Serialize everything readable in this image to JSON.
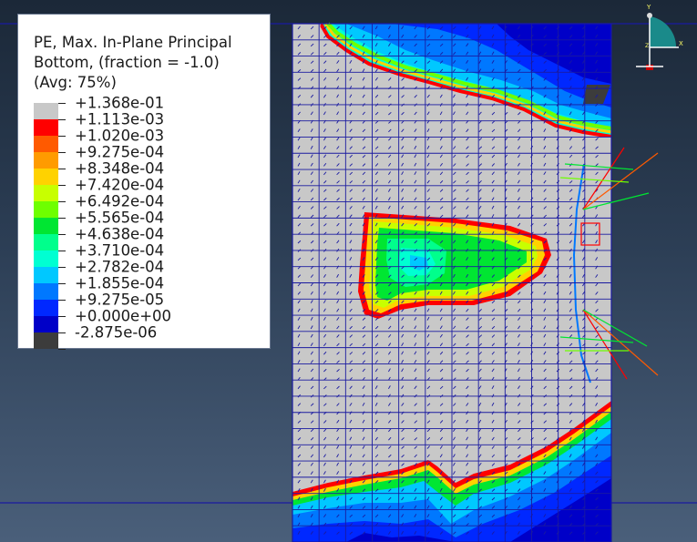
{
  "legend": {
    "title_line1": "PE, Max. In-Plane Principal",
    "title_line2": "Bottom, (fraction = -1.0)",
    "title_line3": "(Avg: 75%)",
    "levels": [
      {
        "label": "+1.368e-01",
        "color": "#c8c8c8"
      },
      {
        "label": "+1.113e-03",
        "color": "#ff0000"
      },
      {
        "label": "+1.020e-03",
        "color": "#ff5a00"
      },
      {
        "label": "+9.275e-04",
        "color": "#ff9b00"
      },
      {
        "label": "+8.348e-04",
        "color": "#ffd200"
      },
      {
        "label": "+7.420e-04",
        "color": "#c8ff00"
      },
      {
        "label": "+6.492e-04",
        "color": "#6eff00"
      },
      {
        "label": "+5.565e-04",
        "color": "#00e632"
      },
      {
        "label": "+4.638e-04",
        "color": "#00ff8c"
      },
      {
        "label": "+3.710e-04",
        "color": "#00ffd2"
      },
      {
        "label": "+2.782e-04",
        "color": "#00c8ff"
      },
      {
        "label": "+1.855e-04",
        "color": "#0078ff"
      },
      {
        "label": "+9.275e-05",
        "color": "#0028ff"
      },
      {
        "label": "+0.000e+00",
        "color": "#0000c8"
      },
      {
        "label": "-2.875e-06",
        "color": "#3c3c3c"
      }
    ],
    "extra_label_top": "+1.368e-01"
  },
  "triad": {
    "y_label": "Y",
    "x_label": "X",
    "z_label": "Z"
  }
}
